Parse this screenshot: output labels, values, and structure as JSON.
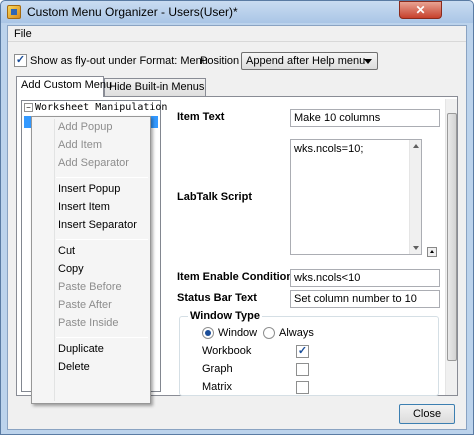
{
  "window": {
    "title": "Custom Menu Organizer - Users(User)*",
    "close_glyph": "✕"
  },
  "menubar": {
    "file": "File"
  },
  "options": {
    "flyout_checkbox_checked": true,
    "flyout_label": "Show as fly-out under Format: Menu",
    "position_label": "Position",
    "position_value": "Append after Help menu"
  },
  "tabs": [
    {
      "label": "Add Custom Menu",
      "active": true
    },
    {
      "label": "Hide Built-in Menus",
      "active": false
    }
  ],
  "tree": {
    "root_label": "Worksheet Manipulation",
    "expander": "−"
  },
  "context_menu": {
    "items": [
      {
        "label": "Add Popup",
        "enabled": false
      },
      {
        "label": "Add Item",
        "enabled": false
      },
      {
        "label": "Add Separator",
        "enabled": false
      },
      {
        "label": "Insert Popup",
        "enabled": true
      },
      {
        "label": "Insert Item",
        "enabled": true
      },
      {
        "label": "Insert Separator",
        "enabled": true
      },
      {
        "label": "Cut",
        "enabled": true
      },
      {
        "label": "Copy",
        "enabled": true
      },
      {
        "label": "Paste Before",
        "enabled": false
      },
      {
        "label": "Paste After",
        "enabled": false
      },
      {
        "label": "Paste Inside",
        "enabled": false
      },
      {
        "label": "Duplicate",
        "enabled": true
      },
      {
        "label": "Delete",
        "enabled": true
      }
    ]
  },
  "form": {
    "item_text_label": "Item Text",
    "item_text_value": "Make 10 columns",
    "labtalk_label": "LabTalk Script",
    "labtalk_value": "wks.ncols=10;",
    "enable_condition_label": "Item Enable Condition",
    "enable_condition_value": "wks.ncols<10",
    "status_bar_label": "Status Bar Text",
    "status_bar_value": "Set column number to 10"
  },
  "window_type": {
    "title": "Window Type",
    "radio_window": "Window",
    "radio_always": "Always",
    "selected": "Window",
    "rows": [
      {
        "label": "Workbook",
        "checked": true
      },
      {
        "label": "Graph",
        "checked": false
      },
      {
        "label": "Matrix",
        "checked": false
      }
    ]
  },
  "footer": {
    "close_label": "Close"
  },
  "check_glyph": "✓"
}
